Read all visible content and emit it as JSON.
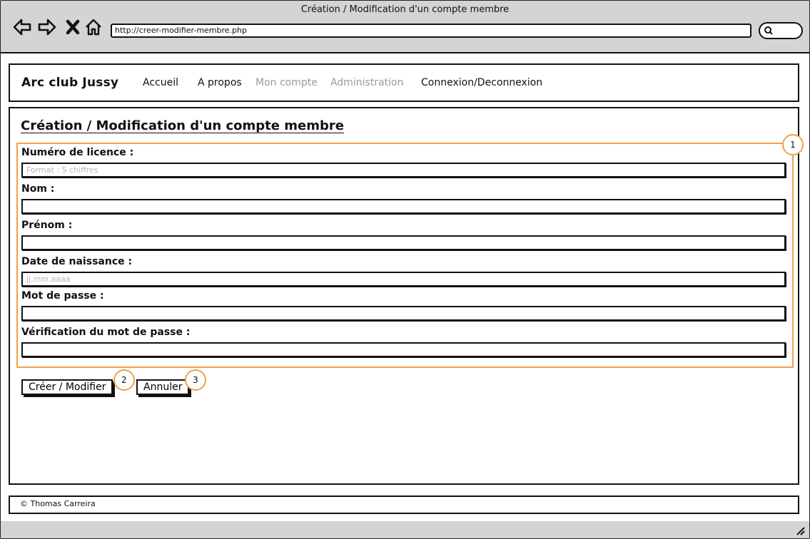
{
  "browser": {
    "window_title": "Création / Modification d'un compte membre",
    "url": "http://creer-modifier-membre.php"
  },
  "header": {
    "brand": "Arc club Jussy",
    "menu": [
      {
        "label": "Accueil",
        "disabled": false
      },
      {
        "label": "A propos",
        "disabled": false
      },
      {
        "label": "Mon compte",
        "disabled": true
      },
      {
        "label": "Administration",
        "disabled": true
      },
      {
        "label": "Connexion/Deconnexion",
        "disabled": false
      }
    ]
  },
  "main": {
    "title": "Création / Modification d'un compte membre",
    "fields": [
      {
        "label": "Numéro de licence :",
        "placeholder": "Format : 5 chiffres",
        "value": ""
      },
      {
        "label": "Nom :",
        "placeholder": "",
        "value": ""
      },
      {
        "label": "Prénom :",
        "placeholder": "",
        "value": ""
      },
      {
        "label": "Date de naissance :",
        "placeholder": "jj.mm.aaaa",
        "value": ""
      },
      {
        "label": "Mot de passe :",
        "placeholder": "",
        "value": ""
      },
      {
        "label": "Vérification du mot de passe :",
        "placeholder": "",
        "value": ""
      }
    ],
    "buttons": {
      "submit": "Créer / Modifier",
      "cancel": "Annuler"
    },
    "callouts": [
      "1",
      "2",
      "3"
    ]
  },
  "footer": {
    "copyright": "© Thomas Carreira"
  },
  "colors": {
    "annotation": "#f0a24a",
    "disabled_text": "#9a9a9a",
    "chrome": "#d4d4d4"
  },
  "icons": [
    "back-arrow-icon",
    "forward-arrow-icon",
    "stop-icon",
    "home-icon",
    "search-icon",
    "resize-grip-icon"
  ]
}
